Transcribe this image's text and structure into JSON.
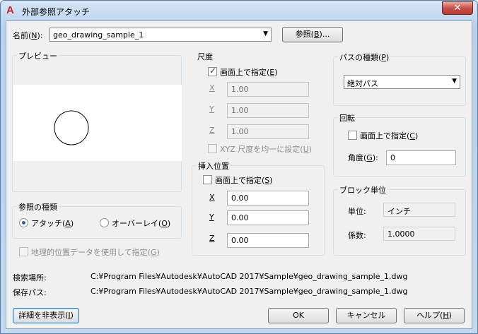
{
  "window": {
    "title": "外部参照アタッチ",
    "close_label": "✕"
  },
  "name_row": {
    "label": "名前(",
    "label_key": "N",
    "label_end": "):",
    "value": "geo_drawing_sample_1",
    "browse_label_pre": "参照(",
    "browse_key": "B",
    "browse_label_post": ")..."
  },
  "preview": {
    "title": "プレビュー"
  },
  "reference_type": {
    "title": "参照の種類",
    "attach_pre": "アタッチ(",
    "attach_key": "A",
    "attach_post": ")",
    "overlay_pre": "オーバーレイ(",
    "overlay_key": "O",
    "overlay_post": ")",
    "selected": "attach"
  },
  "geo": {
    "label_pre": "地理的位置データを使用して指定(",
    "label_key": "G",
    "label_post": ")"
  },
  "scale": {
    "title": "尺度",
    "onscreen_pre": "画面上で指定(",
    "onscreen_key": "E",
    "onscreen_post": ")",
    "x_label": "X",
    "x_value": "1.00",
    "y_label": "Y",
    "y_value": "1.00",
    "z_label": "Z",
    "z_value": "1.00",
    "uniform_pre": "XYZ 尺度を均一に設定(",
    "uniform_key": "U",
    "uniform_post": ")"
  },
  "insertion": {
    "title": "挿入位置",
    "onscreen_pre": "画面上で指定(",
    "onscreen_key": "S",
    "onscreen_post": ")",
    "x_label": "X",
    "x_value": "0.00",
    "y_label": "Y",
    "y_value": "0.00",
    "z_label": "Z",
    "z_value": "0.00"
  },
  "path_type": {
    "title_pre": "パスの種類(",
    "title_key": "P",
    "title_post": ")",
    "value": "絶対パス"
  },
  "rotation": {
    "title": "回転",
    "onscreen_pre": "画面上で指定(",
    "onscreen_key": "C",
    "onscreen_post": ")",
    "angle_pre": "角度(",
    "angle_key": "G",
    "angle_post": "):",
    "angle_value": "0"
  },
  "block_unit": {
    "title": "ブロック単位",
    "unit_label": "単位:",
    "unit_value": "インチ",
    "factor_label": "係数:",
    "factor_value": "1.0000"
  },
  "paths": {
    "found_label": "検索場所:",
    "found_value": "C:¥Program Files¥Autodesk¥AutoCAD 2017¥Sample¥geo_drawing_sample_1.dwg",
    "saved_label": "保存パス:",
    "saved_value": "C:¥Program Files¥Autodesk¥AutoCAD 2017¥Sample¥geo_drawing_sample_1.dwg"
  },
  "footer": {
    "details_pre": "詳細を非表示(",
    "details_key": "I",
    "details_post": ")",
    "ok_label": "OK",
    "cancel_label": "キャンセル",
    "help_pre": "ヘルプ(",
    "help_key": "H",
    "help_post": ")"
  }
}
